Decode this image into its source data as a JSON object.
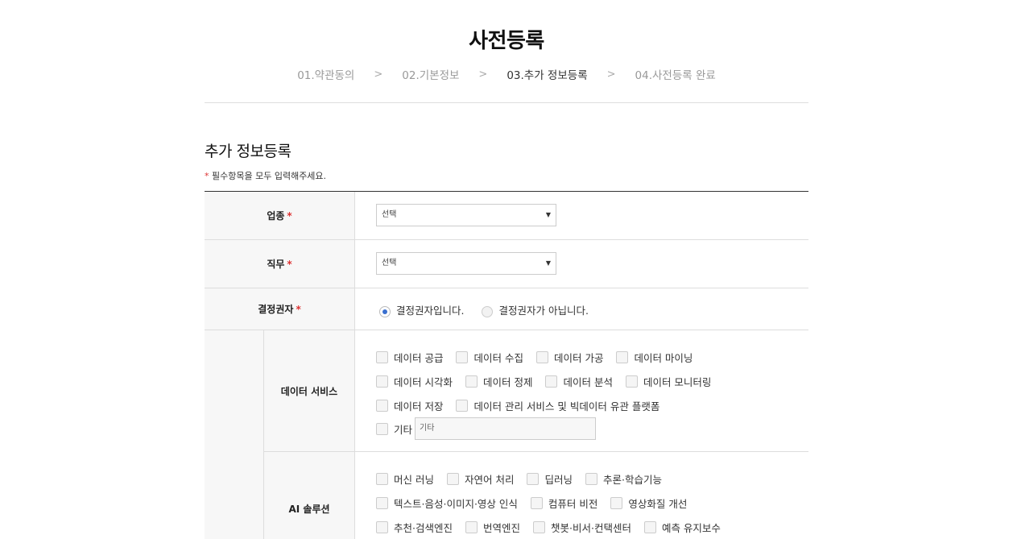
{
  "header": {
    "title": "사전등록",
    "steps": [
      "01.약관동의",
      "02.기본정보",
      "03.추가 정보등록",
      "04.사전등록 완료"
    ],
    "separator": ">"
  },
  "section": {
    "title": "추가 정보등록",
    "required_star": "*",
    "required_note": " 필수항목을 모두 입력해주세요."
  },
  "form": {
    "industry": {
      "label": "업종",
      "star": "*",
      "select_value": "선택"
    },
    "job": {
      "label": "직무",
      "star": "*",
      "select_value": "선택"
    },
    "decision": {
      "label": "결정권자",
      "star": "*",
      "options": [
        "결정권자입니다.",
        "결정권자가 아닙니다."
      ],
      "selected_index": 0
    },
    "data_service": {
      "label": "데이터 서비스",
      "rows": [
        [
          "데이터 공급",
          "데이터 수집",
          "데이터 가공",
          "데이터 마이닝"
        ],
        [
          "데이터 시각화",
          "데이터 정제",
          "데이터 분석",
          "데이터 모니터링"
        ],
        [
          "데이터 저장",
          "데이터 관리 서비스 및 빅데이터 유관 플랫폼"
        ]
      ],
      "etc_label": "기타",
      "etc_placeholder": "기타"
    },
    "ai_solution": {
      "label": "AI 솔루션",
      "rows": [
        [
          "머신 러닝",
          "자연어 처리",
          "딥러닝",
          "추론·학습기능"
        ],
        [
          "텍스트·음성·이미지·영상 인식",
          "컴퓨터 비전",
          "영상화질 개선"
        ],
        [
          "추천·검색엔진",
          "번역엔진",
          "챗봇·비서·컨택센터",
          "예측 유지보수"
        ]
      ]
    }
  }
}
